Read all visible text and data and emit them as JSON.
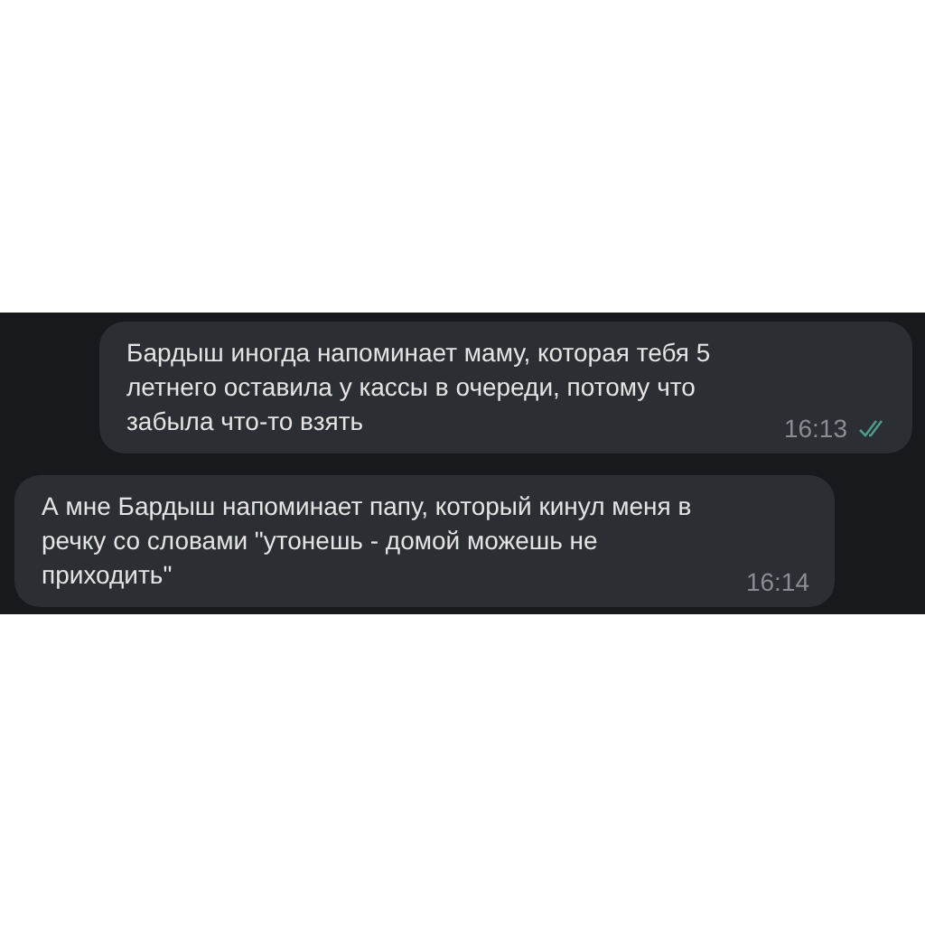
{
  "messages": [
    {
      "kind": "outgoing",
      "text": "Бардыш иногда напоминает маму, которая тебя 5 летнего оставила у кассы в очереди, потому что забыла что-то взять",
      "time": "16:13",
      "read": true
    },
    {
      "kind": "incoming",
      "text": "А мне Бардыш напоминает папу, который кинул меня в речку со словами \"утонешь - домой можешь не приходить\"",
      "time": "16:14"
    }
  ]
}
